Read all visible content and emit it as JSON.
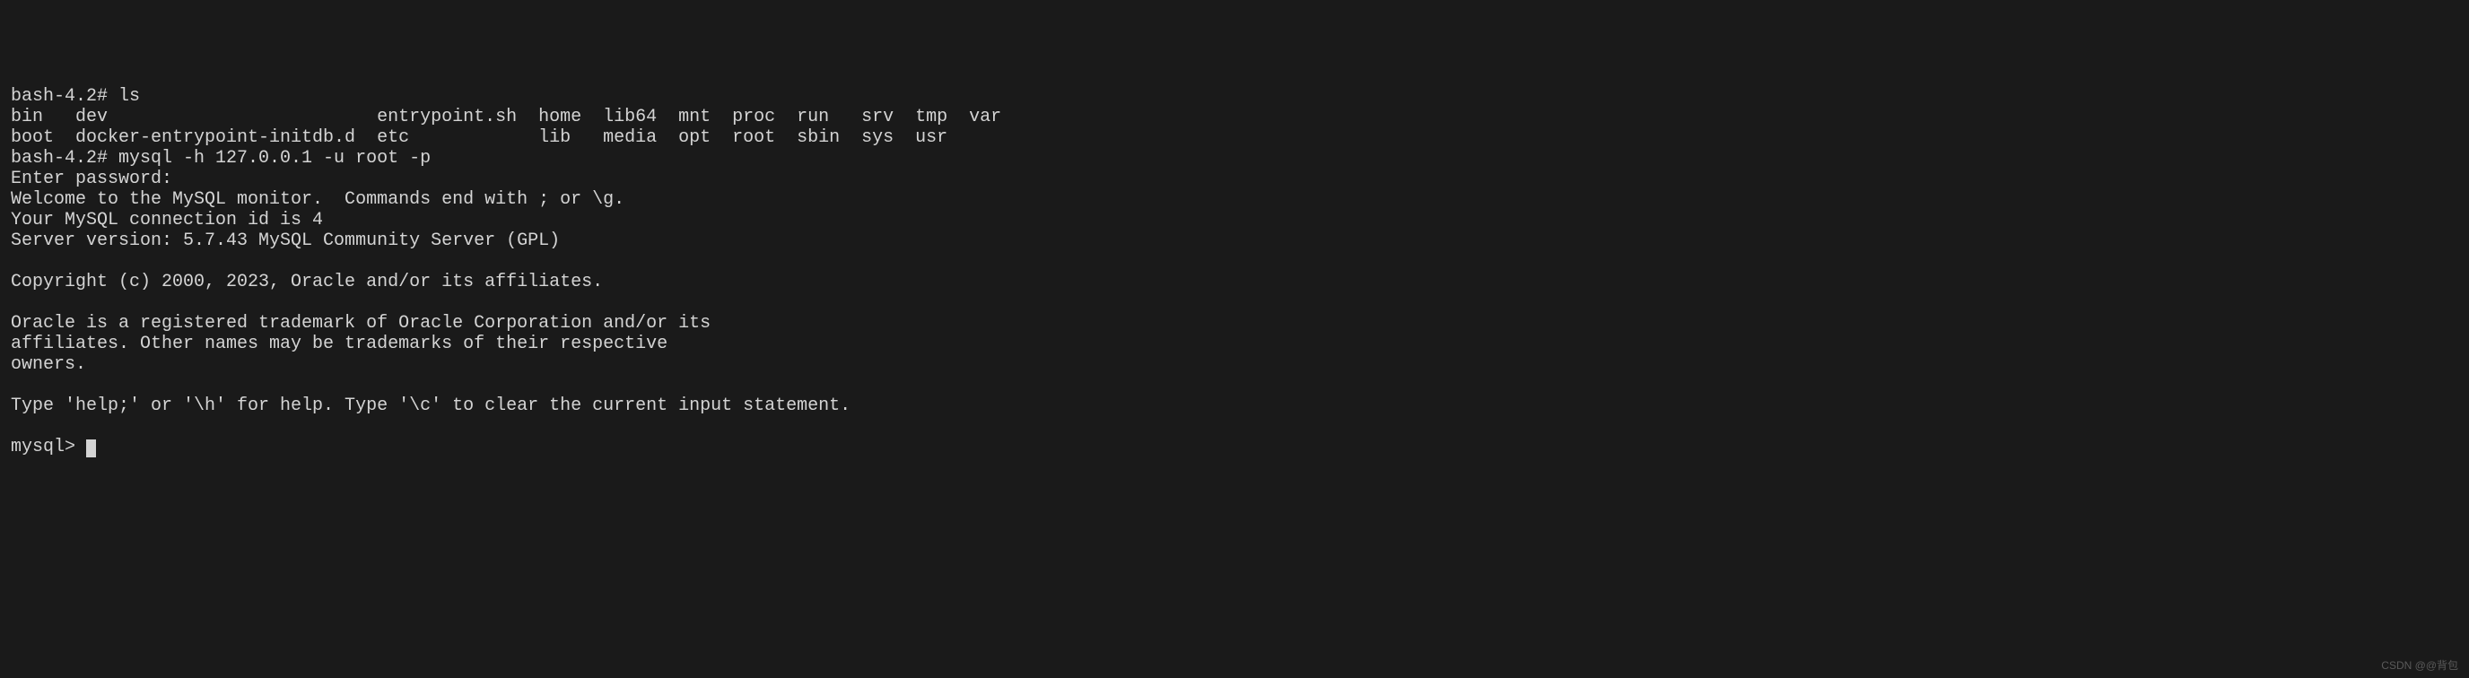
{
  "terminal": {
    "line01": "bash-4.2# ls",
    "line02": "bin   dev                         entrypoint.sh  home  lib64  mnt  proc  run   srv  tmp  var",
    "line03": "boot  docker-entrypoint-initdb.d  etc            lib   media  opt  root  sbin  sys  usr",
    "line04": "bash-4.2# mysql -h 127.0.0.1 -u root -p",
    "line05": "Enter password: ",
    "line06": "Welcome to the MySQL monitor.  Commands end with ; or \\g.",
    "line07": "Your MySQL connection id is 4",
    "line08": "Server version: 5.7.43 MySQL Community Server (GPL)",
    "line09": "",
    "line10": "Copyright (c) 2000, 2023, Oracle and/or its affiliates.",
    "line11": "",
    "line12": "Oracle is a registered trademark of Oracle Corporation and/or its",
    "line13": "affiliates. Other names may be trademarks of their respective",
    "line14": "owners.",
    "line15": "",
    "line16": "Type 'help;' or '\\h' for help. Type '\\c' to clear the current input statement.",
    "line17": "",
    "line18": "mysql> "
  },
  "watermark": "CSDN @@背包"
}
